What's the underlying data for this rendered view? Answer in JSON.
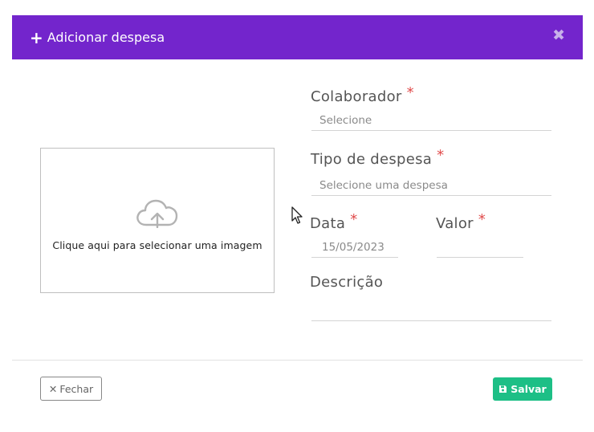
{
  "modal": {
    "title": "Adicionar despesa",
    "header_color": "#7325cc"
  },
  "upload": {
    "text": "Clique aqui para selecionar uma imagem",
    "icon": "cloud-upload-icon"
  },
  "fields": {
    "colaborador": {
      "label": "Colaborador",
      "placeholder": "Selecione",
      "required_mark": "*"
    },
    "tipo_despesa": {
      "label": "Tipo de despesa",
      "placeholder": "Selecione uma despesa",
      "required_mark": "*"
    },
    "data": {
      "label": "Data",
      "placeholder": "15/05/2023",
      "required_mark": "*"
    },
    "valor": {
      "label": "Valor",
      "placeholder": "",
      "required_mark": "*"
    },
    "descricao": {
      "label": "Descrição",
      "placeholder": ""
    }
  },
  "footer": {
    "close_label": "Fechar",
    "save_label": "Salvar",
    "save_color": "#1dbf86"
  }
}
